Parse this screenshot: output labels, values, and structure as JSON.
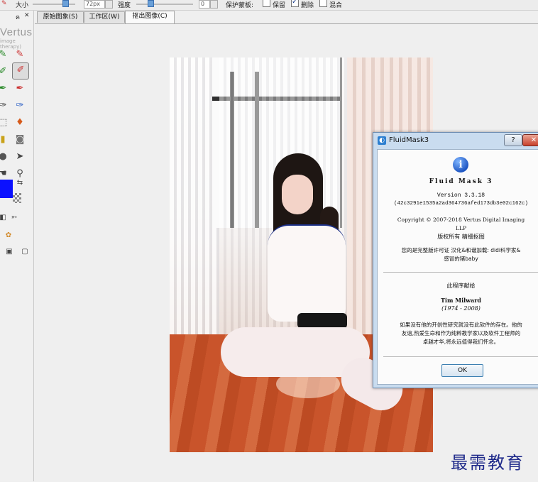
{
  "toolbar": {
    "size_label": "大小",
    "size_value": "72px",
    "strength_label": "强度",
    "strength_value": "0",
    "protect_label": "保护蒙板:",
    "opt_keep": "保留",
    "opt_delete": "删除",
    "opt_mixed": "混合"
  },
  "tool_panel": {
    "pin": "ฅ",
    "close": "✕",
    "logo": "Vertus",
    "logo_sub": "image therapy)",
    "fg_color": "#0b11ff"
  },
  "tabs": [
    {
      "label": "原始图象(S)"
    },
    {
      "label": "工作区(W)"
    },
    {
      "label": "抠出图像(C)"
    }
  ],
  "dialog": {
    "title": "FluidMask3",
    "help": "?",
    "close": "✕",
    "product": "Fluid Mask 3",
    "version": "Version 3.3.18",
    "build": "(42c3291e1535a2ad364736afed173db3e02c162c)",
    "copyright_1": "Copyright © 2007-2018 Vertus Digital Imaging",
    "copyright_2": "LLP",
    "rights": "版权所有 精细抠图",
    "license_1": "您的是完整版许可证 汉化&和谐加载: didi科学家&",
    "license_2": "感冒的猪baby",
    "dedication": "此程序献给",
    "person": "Tim Milward",
    "years": "(1974 - 2008)",
    "tribute_1": "如果没有他的开创性研究就没有此软件的存在。他的",
    "tribute_2": "友谊,热爱生命和作为纯粹教学家以及软件工程师的",
    "tribute_3": "卓越才华,将永远值得我们怀念。",
    "ok": "OK"
  },
  "watermark": "最需教育"
}
